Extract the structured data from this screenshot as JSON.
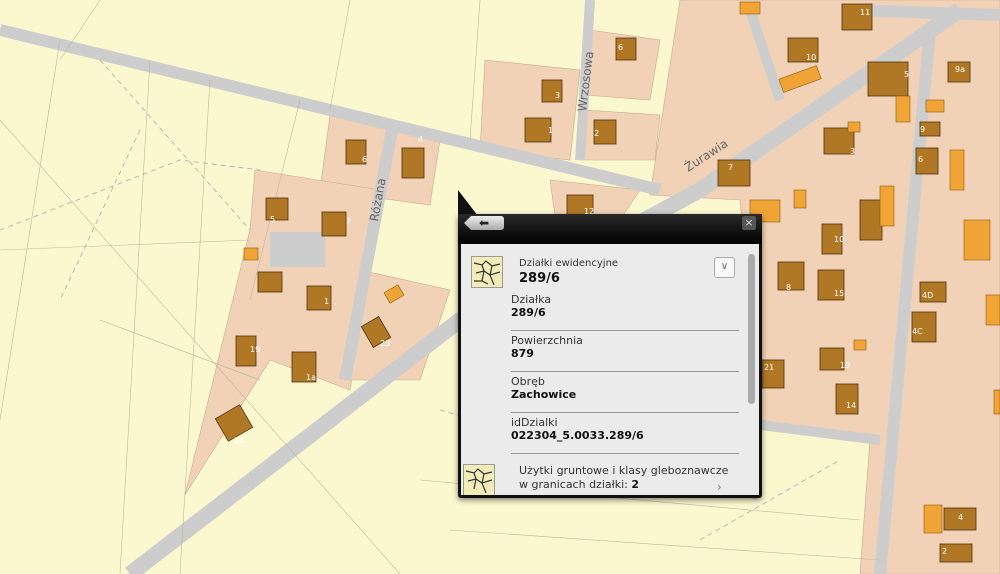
{
  "map": {
    "streets": [
      "Wrzosowa",
      "Różana",
      "Żurawia"
    ],
    "house_numbers": [
      "6",
      "4",
      "5",
      "7",
      "1",
      "19",
      "23",
      "1a",
      "30",
      "12",
      "3",
      "1",
      "2",
      "6",
      "11",
      "10",
      "9a",
      "5",
      "9",
      "3",
      "6",
      "7",
      "8",
      "10",
      "15",
      "4D",
      "4C",
      "10",
      "14",
      "4",
      "2",
      "21"
    ],
    "colors": {
      "background": "#fbf8d0",
      "parcel": "#f1d2b6",
      "building": "#b07824",
      "building_orange": "#f0a436",
      "road": "#cdcdcd",
      "green": "#b9ecb4"
    }
  },
  "popup": {
    "back_label": "back",
    "close_label": "×",
    "layer_title": "Działki ewidencyjne",
    "layer_value": "289/6",
    "fields": [
      {
        "label": "Działka",
        "value": "289/6"
      },
      {
        "label": "Powierzchnia",
        "value": "879"
      },
      {
        "label": "Obręb",
        "value": "Zachowice"
      },
      {
        "label": "idDzialki",
        "value": "022304_5.0033.289/6"
      }
    ],
    "related_text": "Użytki gruntowe i klasy gleboznawcze w granicach działki:",
    "related_count": "2"
  }
}
